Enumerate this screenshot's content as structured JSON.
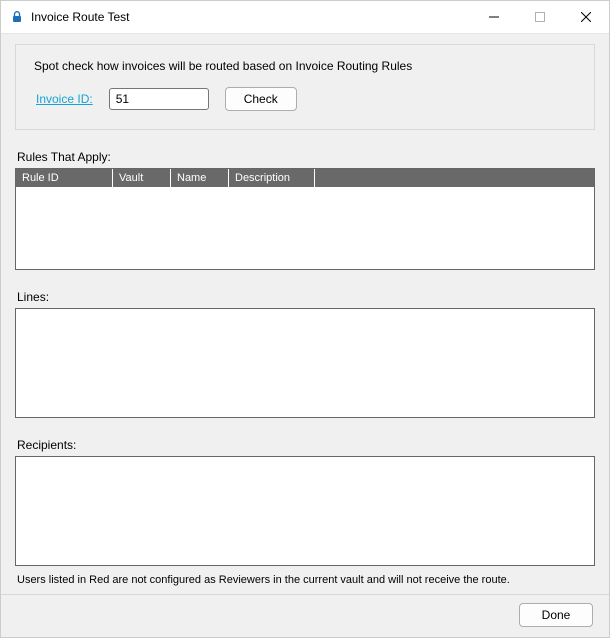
{
  "window": {
    "title": "Invoice Route Test"
  },
  "group": {
    "description": "Spot check how invoices will be routed based on Invoice Routing Rules",
    "invoice_id_label": "Invoice ID:",
    "invoice_id_value": "51",
    "check_label": "Check"
  },
  "sections": {
    "rules_label": "Rules That Apply:",
    "lines_label": "Lines:",
    "recipients_label": "Recipients:"
  },
  "columns": {
    "rule_id": "Rule ID",
    "vault": "Vault",
    "name": "Name",
    "description": "Description"
  },
  "footnote": "Users listed in Red are not configured as Reviewers in the current vault and will not receive the route.",
  "footer": {
    "done_label": "Done"
  }
}
